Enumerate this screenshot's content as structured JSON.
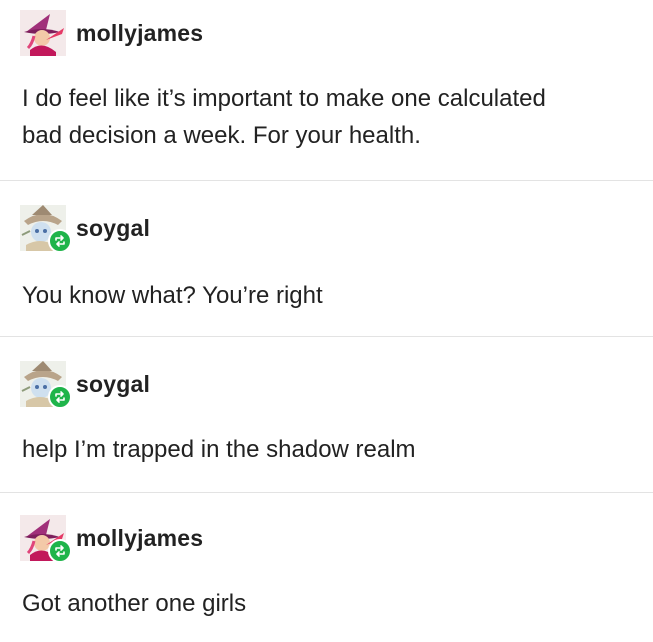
{
  "posts": [
    {
      "username": "mollyjames",
      "text": "I do feel like it’s important to make one calculated\nbad decision a week. For your health.",
      "avatar": "witch-character-avatar",
      "reblogged": false
    },
    {
      "username": "soygal",
      "text": "You know what? You’re right",
      "avatar": "cat-character-avatar",
      "reblogged": true
    },
    {
      "username": "soygal",
      "text": "help I’m trapped in the shadow realm",
      "avatar": "cat-character-avatar",
      "reblogged": true
    },
    {
      "username": "mollyjames",
      "text": "Got another one girls",
      "avatar": "witch-character-avatar",
      "reblogged": true
    }
  ],
  "colors": {
    "reblog_badge": "#1fb44a",
    "divider": "#e3e3e3",
    "text": "#222222"
  }
}
